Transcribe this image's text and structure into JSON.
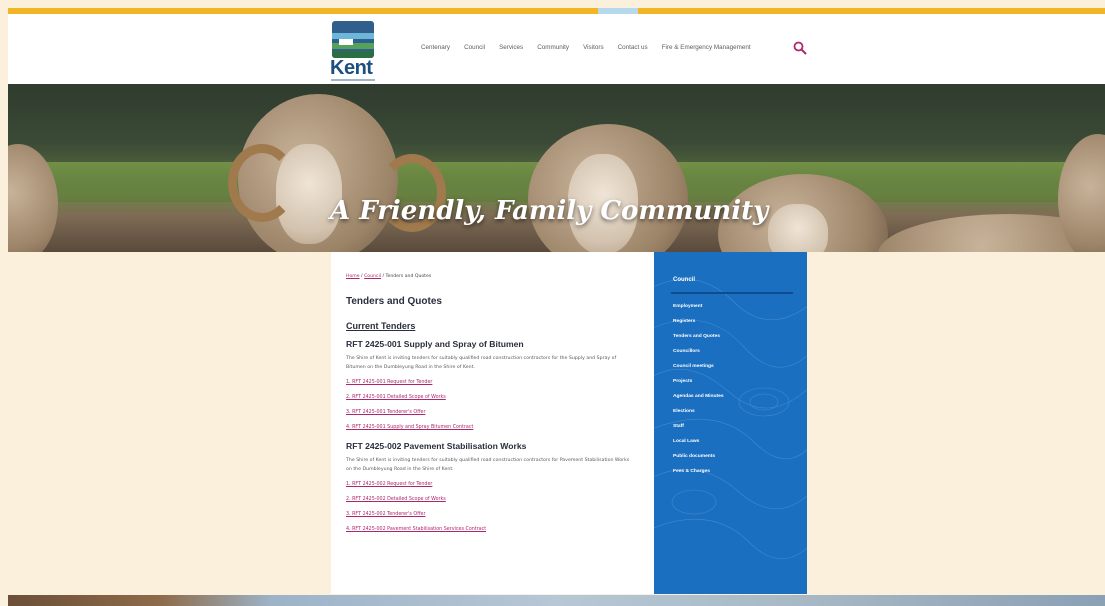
{
  "topbar": {
    "accent": "#f2b523"
  },
  "logo": {
    "text": "Kent"
  },
  "nav": {
    "items": [
      "Centenary",
      "Council",
      "Services",
      "Community",
      "Visitors",
      "Contact us",
      "Fire & Emergency Management"
    ]
  },
  "search": {
    "icon": "search-icon",
    "color": "#b0266a"
  },
  "hero": {
    "tagline": "A Friendly, Family Community"
  },
  "breadcrumb": {
    "home": "Home",
    "sep": "/",
    "council": "Council",
    "current": "Tenders and Quotes"
  },
  "main": {
    "page_title": "Tenders and Quotes",
    "section_title": "Current Tenders",
    "tenders": [
      {
        "title": "RFT 2425-001 Supply and Spray of Bitumen",
        "description": "The Shire of Kent is inviting tenders for suitably qualified road construction contractors for the Supply and Spray of Bitumen on the Dumbleyung Road in the Shire of Kent.",
        "links": [
          "1. RFT 2425-001 Request for Tender",
          "2. RFT 2425-001 Detailed Scope of Works",
          "3. RFT 2425-001 Tenderer's Offer",
          "4. RFT 2425-001 Supply and Spray Bitumen Contract"
        ]
      },
      {
        "title": "RFT 2425-002 Pavement Stabilisation Works",
        "description": "The Shire of Kent is inviting tenders for suitably qualified road construction contractors for Pavement Stabilisation Works on the Dumbleyung Road in the Shire of Kent.",
        "links": [
          "1. RFT 2425-002 Request for Tender",
          "2. RFT 2425-002 Detailed Scope of Works",
          "3. RFT 2425-002 Tenderer's Offer",
          "4. RFT 2425-002 Pavement Stabilisation Services Contract"
        ]
      }
    ]
  },
  "sidebar": {
    "heading": "Council",
    "items": [
      "Employment",
      "Registers",
      "Tenders and Quotes",
      "Councillors",
      "Council meetings",
      "Projects",
      "Agendas and Minutes",
      "Elections",
      "Staff",
      "Local Laws",
      "Public documents",
      "Fees & Charges"
    ],
    "bg": "#1a6fc1"
  },
  "colors": {
    "page_bg": "#fbf0dc",
    "link": "#b0266a",
    "heading": "#2a2e3e"
  }
}
